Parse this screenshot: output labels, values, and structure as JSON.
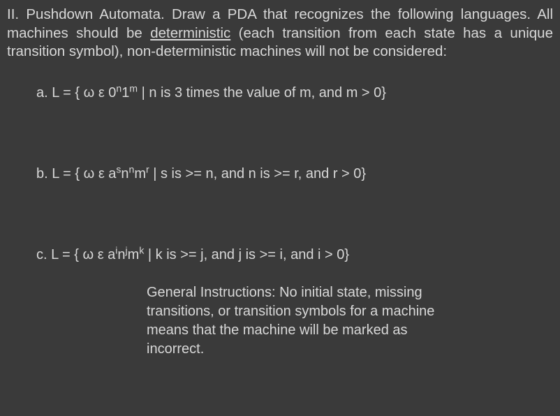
{
  "header": {
    "prefix": "II. Pushdown Automata. Draw a PDA that recognizes the following languages. All machines should be ",
    "underlined": "deterministic",
    "suffix": " (each transition from each state has a unique transition symbol), non-deterministic machines will not be considered:"
  },
  "items": {
    "a": {
      "label": "a.  L = { ω ε 0",
      "sup1": "n",
      "mid1": "1",
      "sup2": "m",
      "rest": " | n is 3 times the value of m, and m > 0}"
    },
    "b": {
      "label": "b.  L = { ω ε a",
      "sup1": "s",
      "mid1": "n",
      "sup2": "n",
      "mid2": "m",
      "sup3": "r",
      "rest": " | s is >= n, and n is >= r, and r > 0}"
    },
    "c": {
      "label": "c.  L = { ω ε a",
      "sup1": "i",
      "mid1": "n",
      "sup2": "j",
      "mid2": "m",
      "sup3": "k",
      "rest": " | k is >= j, and j is >= i, and i > 0}"
    }
  },
  "instructions": "General Instructions: No initial state, missing transitions, or transition symbols for a machine means that the machine will be marked as incorrect."
}
